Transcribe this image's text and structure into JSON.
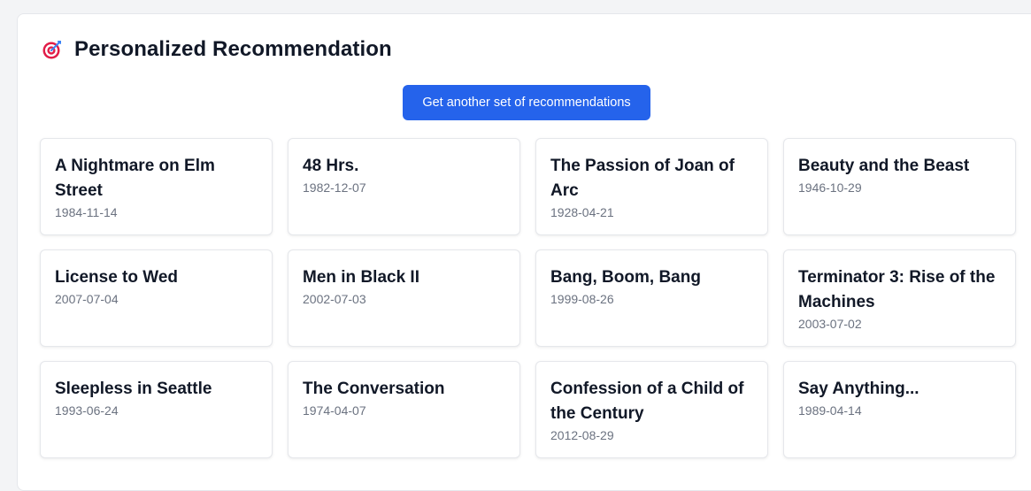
{
  "header": {
    "title": "Personalized Recommendation",
    "icon": "target-dart-icon"
  },
  "actions": {
    "reload_label": "Get another set of recommendations"
  },
  "colors": {
    "accent": "#2563eb",
    "icon_red": "#e11d48",
    "icon_blue": "#3b82f6"
  },
  "movies": [
    {
      "title": "A Nightmare on Elm Street",
      "date": "1984-11-14"
    },
    {
      "title": "48 Hrs.",
      "date": "1982-12-07"
    },
    {
      "title": "The Passion of Joan of Arc",
      "date": "1928-04-21"
    },
    {
      "title": "Beauty and the Beast",
      "date": "1946-10-29"
    },
    {
      "title": "License to Wed",
      "date": "2007-07-04"
    },
    {
      "title": "Men in Black II",
      "date": "2002-07-03"
    },
    {
      "title": "Bang, Boom, Bang",
      "date": "1999-08-26"
    },
    {
      "title": "Terminator 3: Rise of the Machines",
      "date": "2003-07-02"
    },
    {
      "title": "Sleepless in Seattle",
      "date": "1993-06-24"
    },
    {
      "title": "The Conversation",
      "date": "1974-04-07"
    },
    {
      "title": "Confession of a Child of the Century",
      "date": "2012-08-29"
    },
    {
      "title": "Say Anything...",
      "date": "1989-04-14"
    }
  ]
}
